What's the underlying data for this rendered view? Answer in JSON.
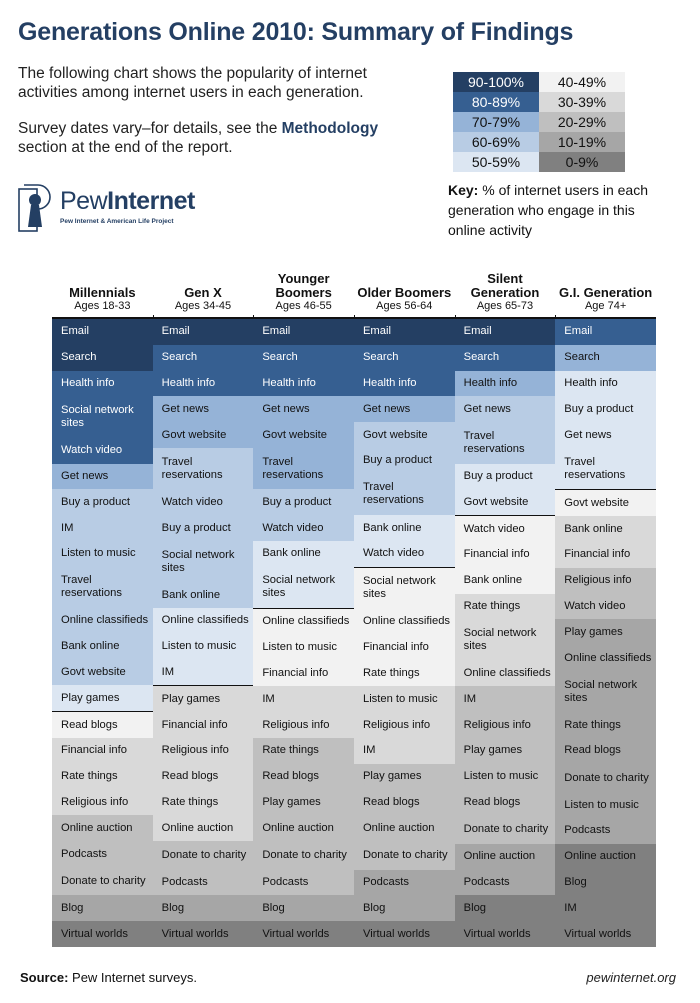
{
  "title": "Generations Online 2010: Summary of Findings",
  "intro": {
    "p1": "The following chart shows the popularity of internet activities among internet users in each generation.",
    "p2_prefix": "Survey dates vary–for details, see the ",
    "p2_link": "Methodology",
    "p2_suffix": " section at the end of the report."
  },
  "logo": {
    "name_regular": "Pew",
    "name_bold": "Internet",
    "subtitle": "Pew Internet & American Life Project",
    "icon": "pew-keyhole-logo-icon"
  },
  "key": {
    "label": "Key:",
    "caption": " % of internet users in each generation who engage in this online activity",
    "tiers": [
      {
        "range": "90-100%",
        "color": "#243f63",
        "text_color": "#ffffff"
      },
      {
        "range": "40-49%",
        "color": "#f2f2f2",
        "text_color": "#111111"
      },
      {
        "range": "80-89%",
        "color": "#365f91",
        "text_color": "#ffffff"
      },
      {
        "range": "30-39%",
        "color": "#d9d9d9",
        "text_color": "#111111"
      },
      {
        "range": "70-79%",
        "color": "#95b3d7",
        "text_color": "#111111"
      },
      {
        "range": "20-29%",
        "color": "#bfbfbf",
        "text_color": "#111111"
      },
      {
        "range": "60-69%",
        "color": "#b8cce4",
        "text_color": "#111111"
      },
      {
        "range": "10-19%",
        "color": "#a6a6a6",
        "text_color": "#111111"
      },
      {
        "range": "50-59%",
        "color": "#dce6f2",
        "text_color": "#111111"
      },
      {
        "range": "0-9%",
        "color": "#808080",
        "text_color": "#111111"
      }
    ]
  },
  "chart_data": {
    "type": "table",
    "title": "Generations Online 2010: Summary of Findings",
    "value_units": "% of internet users (lower bound of 10-point tier)",
    "columns": [
      {
        "name": "Millennials",
        "ages": "Ages 18-33",
        "activities": [
          {
            "label": "Email",
            "tier": 90
          },
          {
            "label": "Search",
            "tier": 90
          },
          {
            "label": "Health info",
            "tier": 80
          },
          {
            "label": "Social network sites",
            "tier": 80,
            "two_line": true
          },
          {
            "label": "Watch video",
            "tier": 80
          },
          {
            "label": "Get news",
            "tier": 70
          },
          {
            "label": "Buy a product",
            "tier": 60
          },
          {
            "label": "IM",
            "tier": 60
          },
          {
            "label": "Listen to music",
            "tier": 60
          },
          {
            "label": "Travel reservations",
            "tier": 60,
            "two_line": true
          },
          {
            "label": "Online classifieds",
            "tier": 60
          },
          {
            "label": "Bank online",
            "tier": 60
          },
          {
            "label": "Govt website",
            "tier": 60
          },
          {
            "label": "Play games",
            "tier": 50
          },
          {
            "label": "Read blogs",
            "tier": 40
          },
          {
            "label": "Financial info",
            "tier": 30
          },
          {
            "label": "Rate things",
            "tier": 30
          },
          {
            "label": "Religious info",
            "tier": 30
          },
          {
            "label": "Online auction",
            "tier": 20
          },
          {
            "label": "Podcasts",
            "tier": 20
          },
          {
            "label": "Donate to charity",
            "tier": 20,
            "two_line": true
          },
          {
            "label": "Blog",
            "tier": 10
          },
          {
            "label": "Virtual worlds",
            "tier": 0
          }
        ]
      },
      {
        "name": "Gen X",
        "ages": "Ages 34-45",
        "activities": [
          {
            "label": "Email",
            "tier": 90
          },
          {
            "label": "Search",
            "tier": 80
          },
          {
            "label": "Health info",
            "tier": 80
          },
          {
            "label": "Get news",
            "tier": 70
          },
          {
            "label": "Govt website",
            "tier": 70
          },
          {
            "label": "Travel reservations",
            "tier": 60,
            "two_line": true
          },
          {
            "label": "Watch video",
            "tier": 60
          },
          {
            "label": "Buy a product",
            "tier": 60
          },
          {
            "label": "Social network sites",
            "tier": 60,
            "two_line": true
          },
          {
            "label": "Bank online",
            "tier": 60
          },
          {
            "label": "Online classifieds",
            "tier": 50
          },
          {
            "label": "Listen to music",
            "tier": 50
          },
          {
            "label": "IM",
            "tier": 50
          },
          {
            "label": "Play games",
            "tier": 30
          },
          {
            "label": "Financial info",
            "tier": 30
          },
          {
            "label": "Religious info",
            "tier": 30
          },
          {
            "label": "Read blogs",
            "tier": 30
          },
          {
            "label": "Rate things",
            "tier": 30
          },
          {
            "label": "Online auction",
            "tier": 30
          },
          {
            "label": "Donate to charity",
            "tier": 20,
            "two_line": true
          },
          {
            "label": "Podcasts",
            "tier": 20
          },
          {
            "label": "Blog",
            "tier": 10
          },
          {
            "label": "Virtual worlds",
            "tier": 0
          }
        ]
      },
      {
        "name": "Younger Boomers",
        "ages": "Ages 46-55",
        "activities": [
          {
            "label": "Email",
            "tier": 90
          },
          {
            "label": "Search",
            "tier": 80
          },
          {
            "label": "Health info",
            "tier": 80
          },
          {
            "label": "Get news",
            "tier": 70
          },
          {
            "label": "Govt website",
            "tier": 70
          },
          {
            "label": "Travel reservations",
            "tier": 70,
            "two_line": true
          },
          {
            "label": "Buy a product",
            "tier": 60
          },
          {
            "label": "Watch video",
            "tier": 60
          },
          {
            "label": "Bank online",
            "tier": 50
          },
          {
            "label": "Social network sites",
            "tier": 50,
            "two_line": true
          },
          {
            "label": "Online classifieds",
            "tier": 40
          },
          {
            "label": "Listen to music",
            "tier": 40
          },
          {
            "label": "Financial info",
            "tier": 40
          },
          {
            "label": "IM",
            "tier": 30
          },
          {
            "label": "Religious info",
            "tier": 30
          },
          {
            "label": "Rate things",
            "tier": 20
          },
          {
            "label": "Read blogs",
            "tier": 20
          },
          {
            "label": "Play games",
            "tier": 20
          },
          {
            "label": "Online auction",
            "tier": 20
          },
          {
            "label": "Donate to charity",
            "tier": 20,
            "two_line": true
          },
          {
            "label": "Podcasts",
            "tier": 20
          },
          {
            "label": "Blog",
            "tier": 10
          },
          {
            "label": "Virtual worlds",
            "tier": 0
          }
        ]
      },
      {
        "name": "Older Boomers",
        "ages": "Ages 56-64",
        "activities": [
          {
            "label": "Email",
            "tier": 90
          },
          {
            "label": "Search",
            "tier": 80
          },
          {
            "label": "Health info",
            "tier": 80
          },
          {
            "label": "Get news",
            "tier": 70
          },
          {
            "label": "Govt website",
            "tier": 60
          },
          {
            "label": "Buy a product",
            "tier": 60
          },
          {
            "label": "Travel reservations",
            "tier": 60,
            "two_line": true
          },
          {
            "label": "Bank online",
            "tier": 50
          },
          {
            "label": "Watch video",
            "tier": 50
          },
          {
            "label": "Social network sites",
            "tier": 40,
            "two_line": true
          },
          {
            "label": "Online classifieds",
            "tier": 40
          },
          {
            "label": "Financial info",
            "tier": 40
          },
          {
            "label": "Rate things",
            "tier": 40
          },
          {
            "label": "Listen to music",
            "tier": 30
          },
          {
            "label": "Religious info",
            "tier": 30
          },
          {
            "label": "IM",
            "tier": 30
          },
          {
            "label": "Play games",
            "tier": 20
          },
          {
            "label": "Read blogs",
            "tier": 20
          },
          {
            "label": "Online auction",
            "tier": 20
          },
          {
            "label": "Donate to charity",
            "tier": 20,
            "two_line": true
          },
          {
            "label": "Podcasts",
            "tier": 10
          },
          {
            "label": "Blog",
            "tier": 10
          },
          {
            "label": "Virtual worlds",
            "tier": 0
          }
        ]
      },
      {
        "name": "Silent Generation",
        "ages": "Ages 65-73",
        "activities": [
          {
            "label": "Email",
            "tier": 90
          },
          {
            "label": "Search",
            "tier": 80
          },
          {
            "label": "Health info",
            "tier": 70
          },
          {
            "label": "Get news",
            "tier": 60
          },
          {
            "label": "Travel reservations",
            "tier": 60,
            "two_line": true
          },
          {
            "label": "Buy a product",
            "tier": 50
          },
          {
            "label": "Govt website",
            "tier": 50
          },
          {
            "label": "Watch video",
            "tier": 40
          },
          {
            "label": "Financial info",
            "tier": 40
          },
          {
            "label": "Bank online",
            "tier": 40
          },
          {
            "label": "Rate things",
            "tier": 30
          },
          {
            "label": "Social network sites",
            "tier": 30,
            "two_line": true
          },
          {
            "label": "Online classifieds",
            "tier": 30
          },
          {
            "label": "IM",
            "tier": 20
          },
          {
            "label": "Religious info",
            "tier": 20
          },
          {
            "label": "Play games",
            "tier": 20
          },
          {
            "label": "Listen to music",
            "tier": 20
          },
          {
            "label": "Read blogs",
            "tier": 20
          },
          {
            "label": "Donate to charity",
            "tier": 20,
            "two_line": true
          },
          {
            "label": "Online auction",
            "tier": 10
          },
          {
            "label": "Podcasts",
            "tier": 10
          },
          {
            "label": "Blog",
            "tier": 0
          },
          {
            "label": "Virtual worlds",
            "tier": 0
          }
        ]
      },
      {
        "name": "G.I. Generation",
        "ages": "Age 74+",
        "activities": [
          {
            "label": "Email",
            "tier": 80
          },
          {
            "label": "Search",
            "tier": 70
          },
          {
            "label": "Health info",
            "tier": 50
          },
          {
            "label": "Buy a product",
            "tier": 50
          },
          {
            "label": "Get news",
            "tier": 50
          },
          {
            "label": "Travel reservations",
            "tier": 50,
            "two_line": true
          },
          {
            "label": "Govt website",
            "tier": 40
          },
          {
            "label": "Bank online",
            "tier": 30
          },
          {
            "label": "Financial info",
            "tier": 30
          },
          {
            "label": "Religious info",
            "tier": 20
          },
          {
            "label": "Watch video",
            "tier": 20
          },
          {
            "label": "Play games",
            "tier": 10
          },
          {
            "label": "Online classifieds",
            "tier": 10
          },
          {
            "label": "Social network sites",
            "tier": 10,
            "two_line": true
          },
          {
            "label": "Rate things",
            "tier": 10
          },
          {
            "label": "Read blogs",
            "tier": 10
          },
          {
            "label": "Donate to charity",
            "tier": 10,
            "two_line": true
          },
          {
            "label": "Listen to music",
            "tier": 10
          },
          {
            "label": "Podcasts",
            "tier": 10
          },
          {
            "label": "Online auction",
            "tier": 0
          },
          {
            "label": "Blog",
            "tier": 0
          },
          {
            "label": "IM",
            "tier": 0
          },
          {
            "label": "Virtual worlds",
            "tier": 0
          }
        ]
      }
    ]
  },
  "footer": {
    "source_label": "Source:",
    "source_text": " Pew Internet surveys.",
    "url": "pewinternet.org"
  }
}
